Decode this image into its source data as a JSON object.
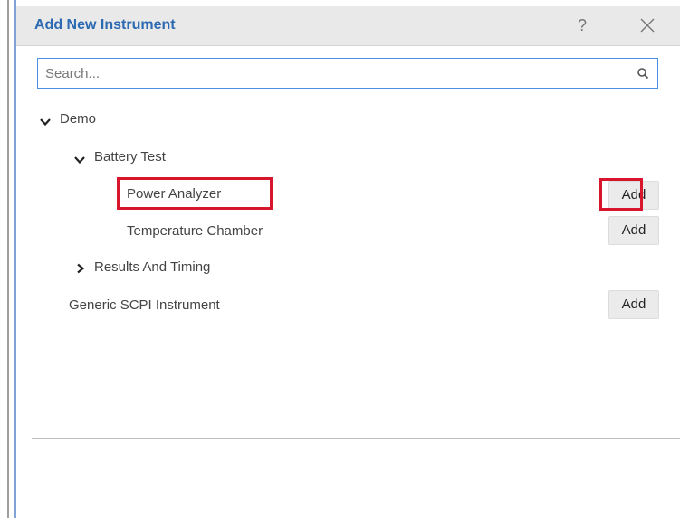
{
  "dialog": {
    "title": "Add New Instrument",
    "help_label": "?"
  },
  "search": {
    "placeholder": "Search...",
    "value": ""
  },
  "tree": {
    "demo": {
      "label": "Demo",
      "expanded": true
    },
    "battery_test": {
      "label": "Battery Test",
      "expanded": true
    },
    "power_analyzer": {
      "label": "Power Analyzer",
      "add_label": "Add"
    },
    "temperature_chamber": {
      "label": "Temperature Chamber",
      "add_label": "Add"
    },
    "results_and_timing": {
      "label": "Results And Timing",
      "expanded": false
    },
    "generic_scpi": {
      "label": "Generic SCPI Instrument",
      "add_label": "Add"
    }
  },
  "colors": {
    "title": "#2c6ab1",
    "highlight": "#d7152c",
    "search_border": "#4a90e2",
    "panel_border": "#7fa3d6"
  },
  "icons": [
    "help-icon",
    "close-icon",
    "search-icon",
    "chevron-down-icon",
    "chevron-right-icon"
  ]
}
